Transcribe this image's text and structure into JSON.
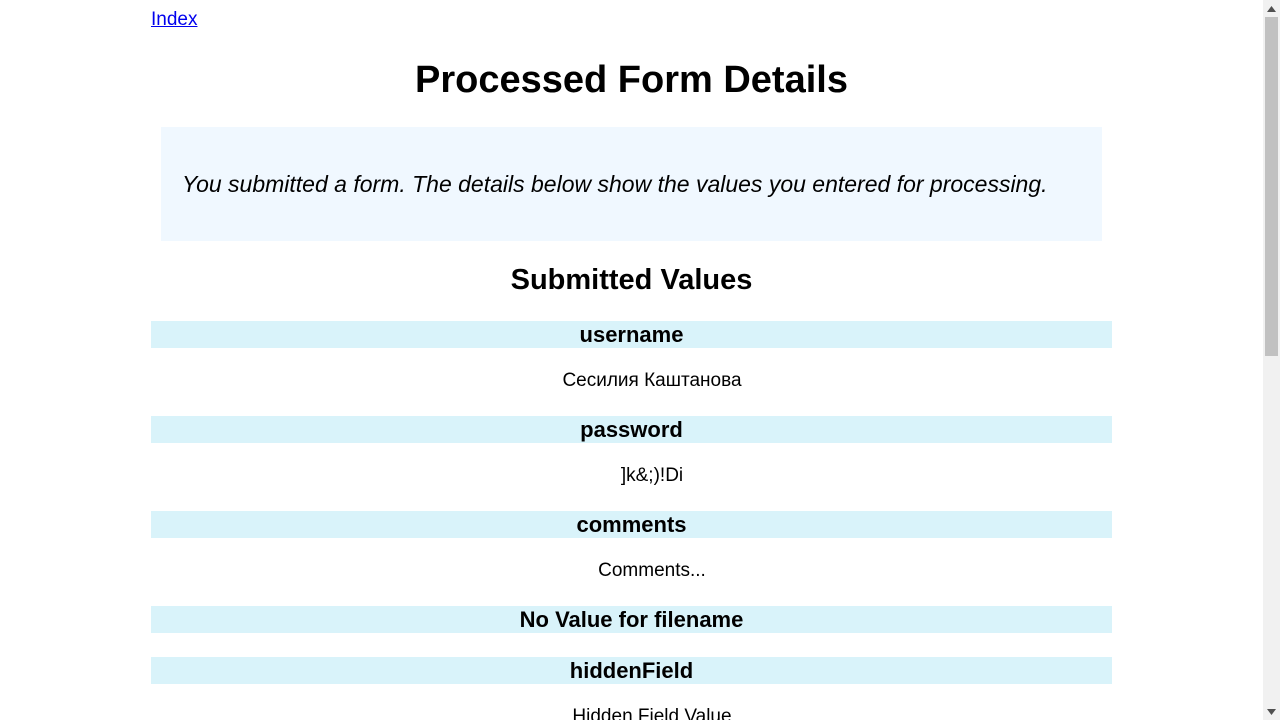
{
  "nav": {
    "index_link": "Index"
  },
  "page_title": "Processed Form Details",
  "explanation": "You submitted a form. The details below show the values you entered for processing.",
  "values_heading": "Submitted Values",
  "fields": [
    {
      "heading": "username",
      "value": "Сесилия Каштанова"
    },
    {
      "heading": "password",
      "value": "]k&;)!Di"
    },
    {
      "heading": "comments",
      "value": "Comments..."
    },
    {
      "heading": "No Value for filename",
      "value": ""
    },
    {
      "heading": "hiddenField",
      "value": "Hidden Field Value"
    }
  ],
  "colors": {
    "explanation_background": "#f0f8ff",
    "field_heading_background": "#d9f3fa",
    "link": "#0000ee"
  },
  "scrollbar": {
    "up_icon": "triangle-up-icon",
    "down_icon": "triangle-down-icon"
  }
}
